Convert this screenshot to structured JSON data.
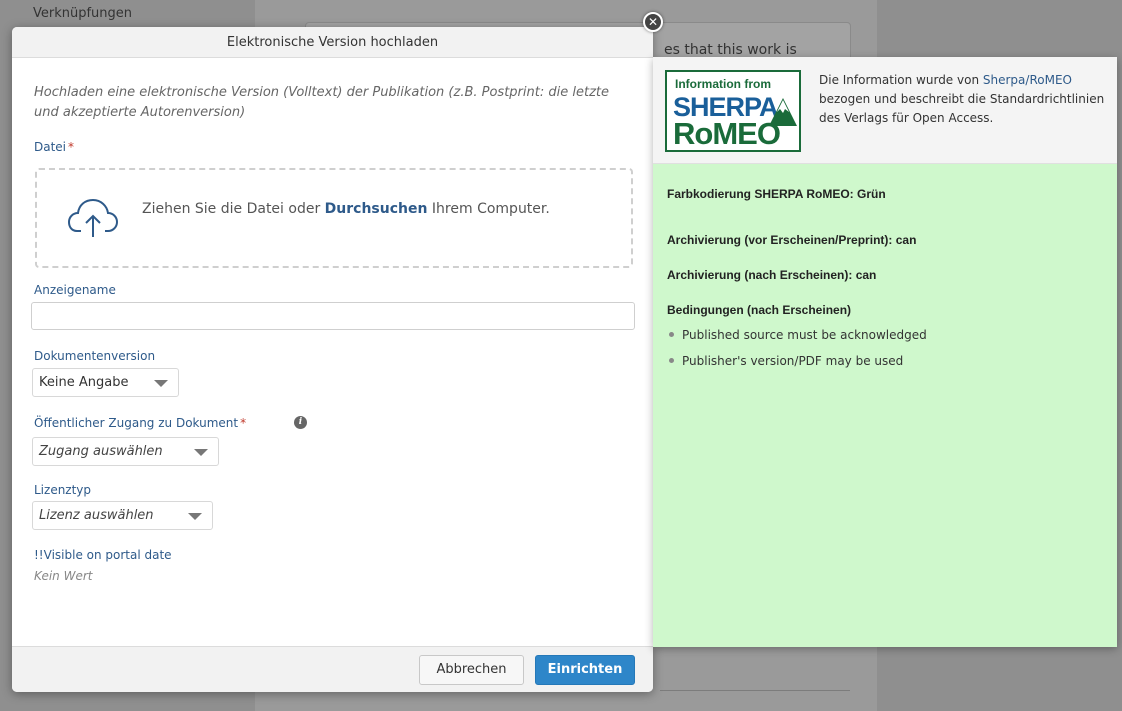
{
  "background": {
    "links_label": "Verknüpfungen",
    "peek_text": "es that this work is"
  },
  "dialog": {
    "title": "Elektronische Version hochladen",
    "intro": "Hochladen eine elektronische Version (Volltext) der Publikation (z.B. Postprint: die letzte und akzeptierte Autorenversion)",
    "file_label": "Datei",
    "required_mark": "*",
    "dropzone_text_before": "Ziehen Sie die Datei oder",
    "dropzone_link": "Durchsuchen",
    "dropzone_text_after": "Ihrem Computer.",
    "display_name_label": "Anzeigename",
    "display_name_value": "",
    "doc_version_label": "Dokumentenversion",
    "doc_version_value": "Keine Angabe",
    "access_label": "Öffentlicher Zugang zu Dokument",
    "access_value": "Zugang auswählen",
    "license_label": "Lizenztyp",
    "license_value": "Lizenz auswählen",
    "visible_date_label": "!!Visible on portal date",
    "visible_date_value": "Kein Wert",
    "cancel_label": "Abbrechen",
    "submit_label": "Einrichten",
    "close_glyph": "✕",
    "info_glyph": "i"
  },
  "romeo": {
    "logo_line1": "Information from",
    "logo_line2": "SHERPA",
    "logo_line3": "RoMEO",
    "desc_part1": "Die Information wurde von",
    "desc_link": "Sherpa/RoMEO",
    "desc_part2": "bezogen und beschreibt die Standardrichtlinien des Verlags für Open Access.",
    "color_coding": "Farbkodierung SHERPA RoMEO: Grün",
    "pre_archiving": "Archivierung (vor Erscheinen/Preprint): can",
    "post_archiving": "Archivierung (nach Erscheinen): can",
    "conditions_title": "Bedingungen (nach Erscheinen)",
    "conditions": [
      "Published source must be acknowledged",
      "Publisher's version/PDF may be used"
    ]
  },
  "colors": {
    "accent_blue": "#2e86c9",
    "label_blue": "#2e5a8a",
    "required_red": "#c0392b",
    "romeo_green": "#cff8cc"
  },
  "icons": {
    "upload": "cloud-upload-icon",
    "info": "info-icon",
    "close": "close-icon",
    "dropdown": "chevron-down-icon"
  }
}
